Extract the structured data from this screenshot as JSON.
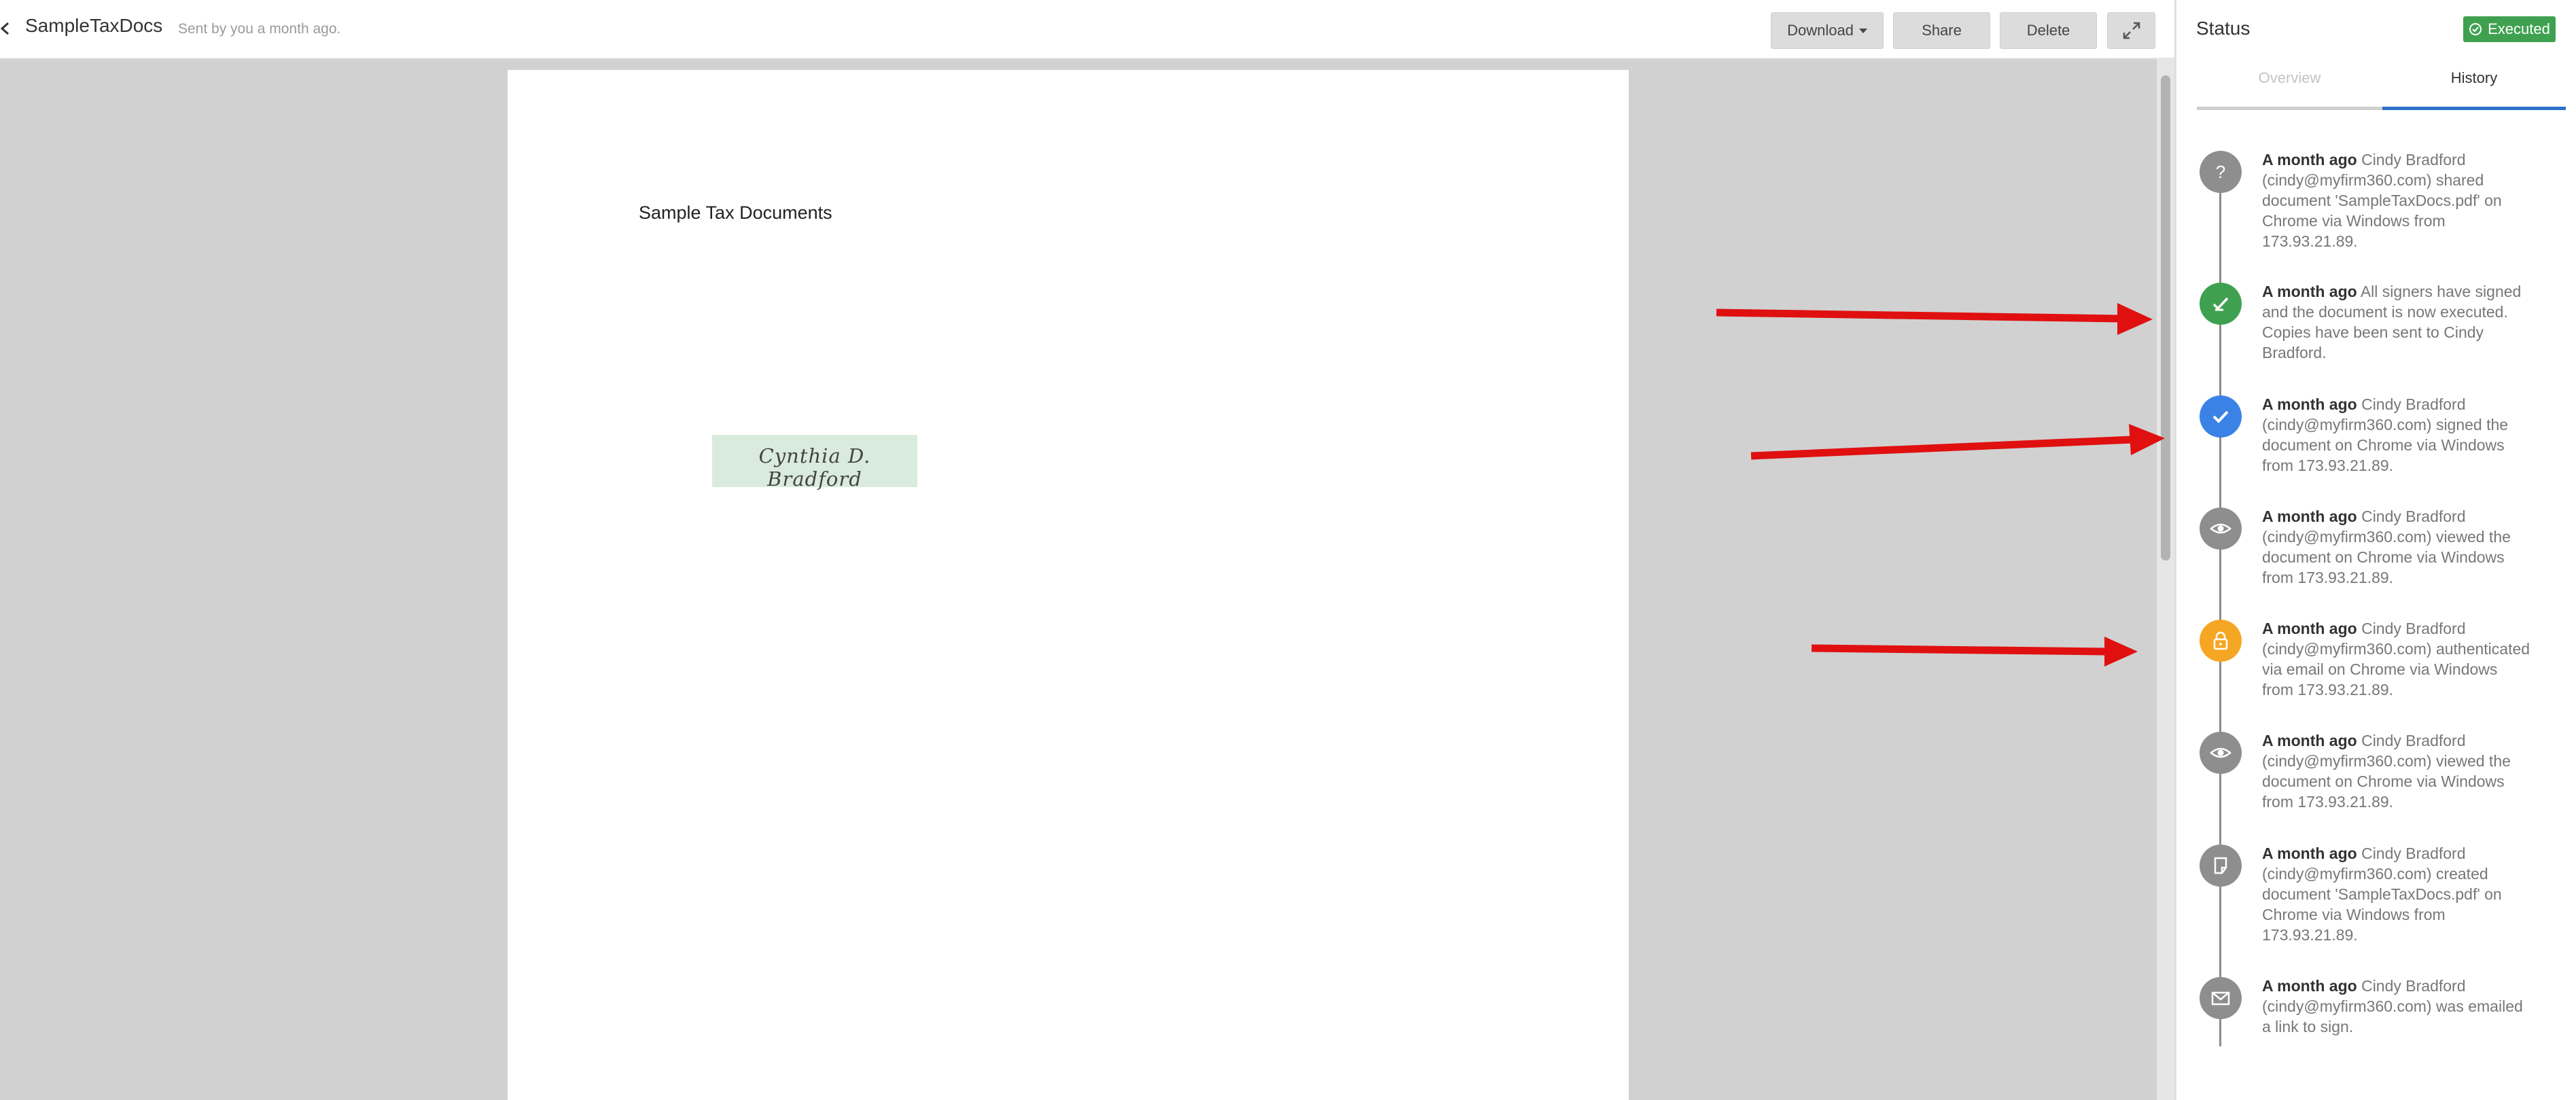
{
  "header": {
    "title": "SampleTaxDocs",
    "sent_info": "Sent by you a month ago.",
    "download_label": "Download",
    "share_label": "Share",
    "delete_label": "Delete"
  },
  "document": {
    "heading": "Sample Tax Documents",
    "signature": "Cynthia D. Bradford"
  },
  "panel": {
    "title": "Status",
    "status_badge": "Executed",
    "tabs": [
      {
        "label": "Overview",
        "active": false
      },
      {
        "label": "History",
        "active": true
      }
    ],
    "history": [
      {
        "when": "A month ago",
        "text": "Cindy Bradford (cindy@myfirm360.com) shared document 'SampleTaxDocs.pdf' on Chrome via Windows from 173.93.21.89.",
        "icon": "question-icon",
        "color": "#8e8e8e"
      },
      {
        "when": "A month ago",
        "text": "All signers have signed and the document is now executed. Copies have been sent to Cindy Bradford.",
        "icon": "executed-icon",
        "color": "#3fa14f"
      },
      {
        "when": "A month ago",
        "text": "Cindy Bradford (cindy@myfirm360.com) signed the document on Chrome via Windows from 173.93.21.89.",
        "icon": "check-icon",
        "color": "#3b82e6"
      },
      {
        "when": "A month ago",
        "text": "Cindy Bradford (cindy@myfirm360.com) viewed the document on Chrome via Windows from 173.93.21.89.",
        "icon": "eye-icon",
        "color": "#8e8e8e"
      },
      {
        "when": "A month ago",
        "text": "Cindy Bradford (cindy@myfirm360.com) authenticated via email on Chrome via Windows from 173.93.21.89.",
        "icon": "lock-icon",
        "color": "#f5a623"
      },
      {
        "when": "A month ago",
        "text": "Cindy Bradford (cindy@myfirm360.com) viewed the document on Chrome via Windows from 173.93.21.89.",
        "icon": "eye-icon",
        "color": "#8e8e8e"
      },
      {
        "when": "A month ago",
        "text": "Cindy Bradford (cindy@myfirm360.com) created document 'SampleTaxDocs.pdf' on Chrome via Windows from 173.93.21.89.",
        "icon": "document-icon",
        "color": "#8e8e8e"
      },
      {
        "when": "A month ago",
        "text": "Cindy Bradford (cindy@myfirm360.com) was emailed a link to sign.",
        "icon": "envelope-icon",
        "color": "#8e8e8e"
      }
    ]
  },
  "colors": {
    "accent": "#2d72c8",
    "executed": "#3fa14f",
    "annotation_arrow": "#e01010"
  }
}
